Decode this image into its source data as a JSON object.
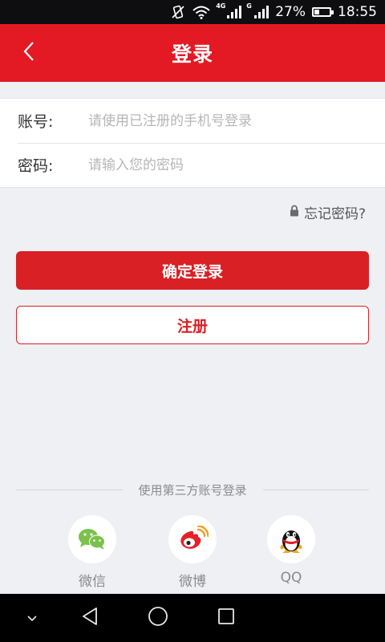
{
  "status_bar": {
    "network_4g": "4G",
    "network_g": "G",
    "battery": "27%",
    "time": "18:55"
  },
  "header": {
    "title": "登录",
    "back_icon": "chevron-left-icon"
  },
  "form": {
    "account_label": "账号:",
    "account_placeholder": "请使用已注册的手机号登录",
    "password_label": "密码:",
    "password_placeholder": "请输入您的密码"
  },
  "forgot_password": "忘记密码?",
  "buttons": {
    "login": "确定登录",
    "register": "注册"
  },
  "third_party": {
    "title": "使用第三方账号登录",
    "items": [
      {
        "label": "微信",
        "icon": "wechat-icon"
      },
      {
        "label": "微博",
        "icon": "weibo-icon"
      },
      {
        "label": "QQ",
        "icon": "qq-icon"
      }
    ]
  },
  "colors": {
    "brand_red": "#e31a23",
    "button_red": "#d82025",
    "wechat_green": "#7bc14b"
  }
}
